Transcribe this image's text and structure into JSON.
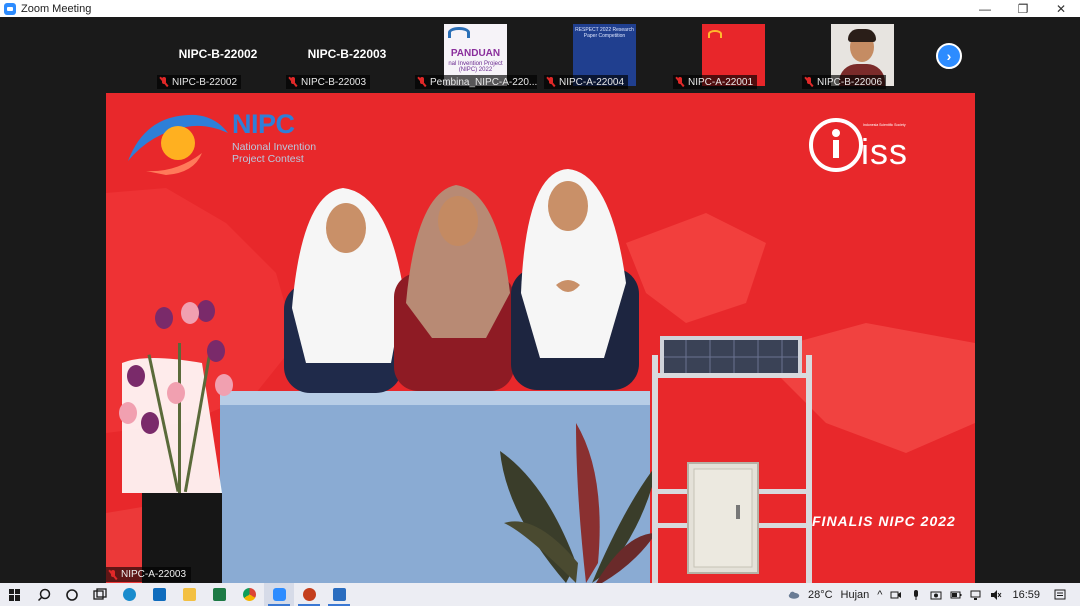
{
  "window": {
    "title": "Zoom Meeting",
    "controls": [
      "—",
      "❐",
      "✕"
    ]
  },
  "gallery": {
    "tiles": [
      {
        "big_name": "NIPC-B-22002",
        "label": "NIPC-B-22002",
        "kind": "name"
      },
      {
        "big_name": "NIPC-B-22003",
        "label": "NIPC-B-22003",
        "kind": "name"
      },
      {
        "label": "Pembina_NIPC-A-220...",
        "kind": "panduan",
        "thumb_title": "PANDUAN",
        "thumb_sub": "nal Invention Project (NIPC) 2022"
      },
      {
        "label": "NIPC-A-22004",
        "kind": "respect",
        "thumb_title": "RESPECT 2022 Research Paper Competition"
      },
      {
        "label": "NIPC-A-22001",
        "kind": "nipc"
      },
      {
        "label": "NIPC-B-22006",
        "kind": "person"
      }
    ],
    "next_arrow": "›"
  },
  "main": {
    "brand": "NIPC",
    "brand_sub": "National Invention Project Contest",
    "iss": "iss",
    "iss_sub": "Indonesia Scientific Society",
    "caption": "FINALIS NIPC 2022",
    "speaker_label": "NIPC-A-22003"
  },
  "taskbar": {
    "apps": [
      "start",
      "search",
      "cortana",
      "task-view",
      "edge",
      "mail",
      "file-explorer",
      "excel",
      "chrome",
      "zoom",
      "powerpoint",
      "photos"
    ],
    "weather": "28°C",
    "weather_text": "Hujan",
    "time": "16:59"
  },
  "colors": {
    "zoom_blue": "#2d8cff",
    "muted_red": "#e02828",
    "backdrop_red": "#e8282b",
    "nipc_blue": "#2e7fd8"
  }
}
